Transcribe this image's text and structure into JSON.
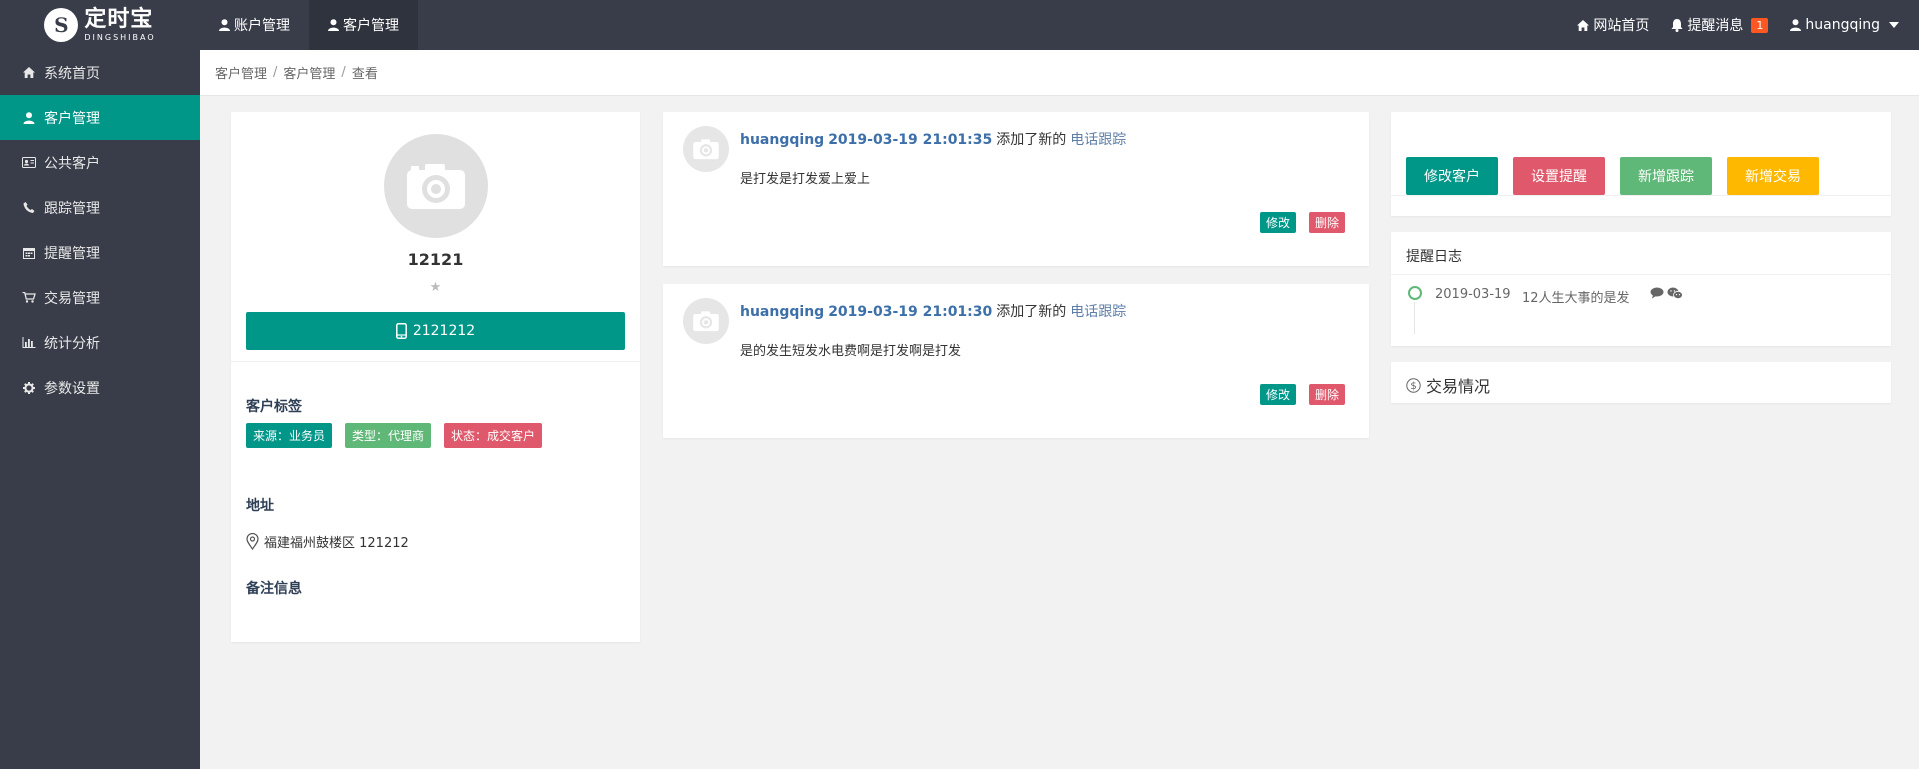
{
  "brand": {
    "name_cn": "定时宝",
    "name_en": "DINGSHIBAO",
    "mark": "S"
  },
  "topnav": [
    {
      "label": "账户管理",
      "active": false
    },
    {
      "label": "客户管理",
      "active": true
    }
  ],
  "topright": {
    "home_label": "网站首页",
    "notify_label": "提醒消息",
    "notify_count": "1",
    "username": "huangqing"
  },
  "sidebar": {
    "items": [
      {
        "label": "系统首页",
        "icon": "home-icon"
      },
      {
        "label": "客户管理",
        "icon": "user-icon",
        "active": true
      },
      {
        "label": "公共客户",
        "icon": "id-card-icon"
      },
      {
        "label": "跟踪管理",
        "icon": "phone-icon"
      },
      {
        "label": "提醒管理",
        "icon": "calendar-icon"
      },
      {
        "label": "交易管理",
        "icon": "cart-icon"
      },
      {
        "label": "统计分析",
        "icon": "bar-chart-icon"
      },
      {
        "label": "参数设置",
        "icon": "gear-icon"
      }
    ]
  },
  "breadcrumb": [
    "客户管理",
    "客户管理",
    "查看"
  ],
  "profile": {
    "name": "12121",
    "star": "★",
    "phone": "2121212",
    "tags_title": "客户标签",
    "tags": [
      {
        "label": "来源：业务员",
        "color": "#009688"
      },
      {
        "label": "类型：代理商",
        "color": "#5fb878"
      },
      {
        "label": "状态：成交客户",
        "color": "#e0586b"
      }
    ],
    "address_title": "地址",
    "address": "福建福州鼓楼区 121212",
    "note_title": "备注信息"
  },
  "followups": [
    {
      "user": "huangqing",
      "time": "2019-03-19 21:01:35",
      "action": "添加了新的",
      "type": "电话跟踪",
      "content": "是打发是打发爱上爱上",
      "edit_label": "修改",
      "delete_label": "删除"
    },
    {
      "user": "huangqing",
      "time": "2019-03-19 21:01:30",
      "action": "添加了新的",
      "type": "电话跟踪",
      "content": "是的发生短发水电费啊是打发啊是打发",
      "edit_label": "修改",
      "delete_label": "删除"
    }
  ],
  "actions": {
    "edit_customer": "修改客户",
    "set_reminder": "设置提醒",
    "add_followup": "新增跟踪",
    "add_trade": "新增交易"
  },
  "remind_log": {
    "title": "提醒日志",
    "entries": [
      {
        "date": "2019-03-19",
        "text": "12人生大事的是发"
      }
    ]
  },
  "trade": {
    "title": "交易情况"
  },
  "colors": {
    "teal": "#009688",
    "red": "#e0586b",
    "green": "#5fb878",
    "amber": "#ffb800",
    "dark": "#393d49"
  }
}
